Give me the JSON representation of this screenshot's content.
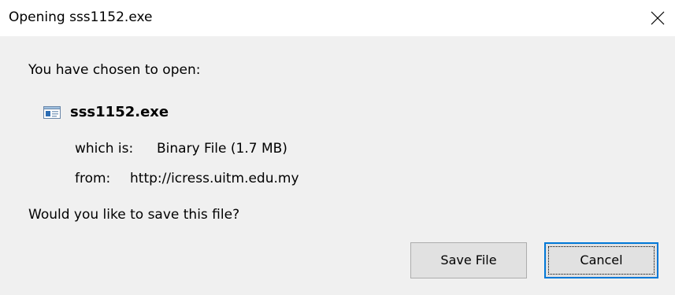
{
  "window": {
    "title": "Opening sss1152.exe",
    "close_icon": "close-icon"
  },
  "content": {
    "intro": "You have chosen to open:",
    "file": {
      "icon": "executable-file-icon",
      "name": "sss1152.exe"
    },
    "type_label": "which is:",
    "type_value": "Binary File (1.7 MB)",
    "from_label": "from:",
    "from_value": "http://icress.uitm.edu.my",
    "question": "Would you like to save this file?"
  },
  "buttons": {
    "save": "Save File",
    "cancel": "Cancel"
  },
  "colors": {
    "dialog_bg": "#f0f0f0",
    "titlebar_bg": "#ffffff",
    "button_bg": "#e1e1e1",
    "focus_accent": "#0078d7"
  }
}
